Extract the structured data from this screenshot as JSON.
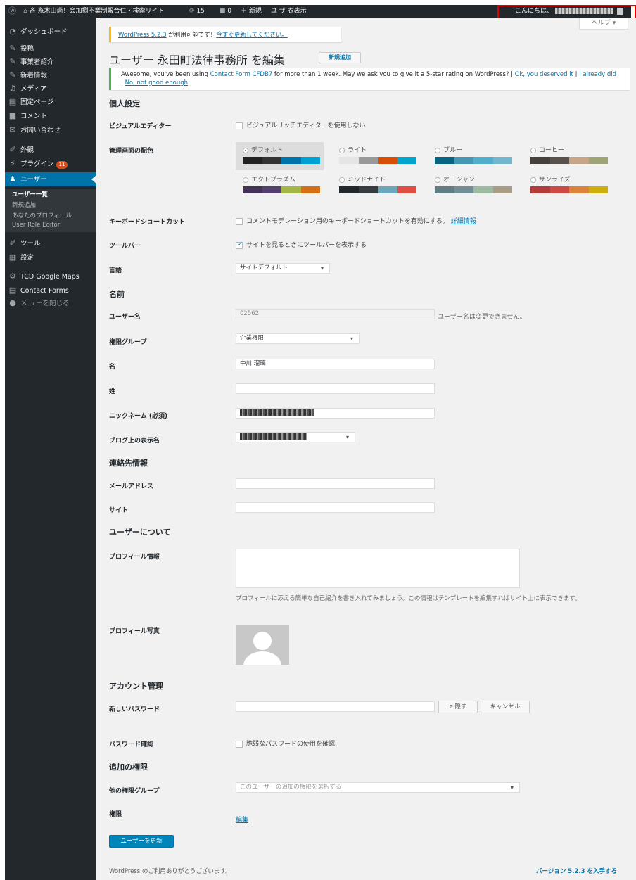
{
  "admin_bar": {
    "site_name": "吝 糸木山尚！会加捌不業制報合仁・検索リイト",
    "updates": "15",
    "comments": "0",
    "new": "新規",
    "user_view": "ユ ザ 衣表示",
    "greeting": "こんにちは、"
  },
  "sidebar": {
    "items": [
      {
        "label": "ダッシュボード",
        "icon": "dashboard-icon"
      },
      {
        "label": "投稿",
        "icon": "pin-icon"
      },
      {
        "label": "事業者紹介",
        "icon": "pin-icon"
      },
      {
        "label": "新着情報",
        "icon": "pin-icon"
      },
      {
        "label": "メディア",
        "icon": "media-icon"
      },
      {
        "label": "固定ページ",
        "icon": "page-icon"
      },
      {
        "label": "コメント",
        "icon": "comment-icon"
      },
      {
        "label": "お問い合わせ",
        "icon": "mail-icon"
      },
      {
        "label": "外観",
        "icon": "appearance-icon"
      },
      {
        "label": "プラグイン",
        "icon": "plugin-icon",
        "badge": "11"
      },
      {
        "label": "ユーザー",
        "icon": "user-icon"
      },
      {
        "label": "ツール",
        "icon": "tools-icon"
      },
      {
        "label": "設定",
        "icon": "settings-icon"
      },
      {
        "label": "TCD Google Maps",
        "icon": "gear-icon"
      },
      {
        "label": "Contact Forms",
        "icon": "form-icon"
      },
      {
        "label": "メ ューを閉じる",
        "icon": "collapse-icon"
      }
    ],
    "submenu": [
      "ユーザー一覧",
      "新規追加",
      "あなたのプロフィール",
      "User Role Editor"
    ]
  },
  "help_label": "ヘルプ ▾",
  "notice_update": {
    "link1": "WordPress 5.2.3",
    "text": " が利用可能です！",
    "link2": "今すぐ更新してください。"
  },
  "page_title": "ユーザー 永田町法律事務所 を編集",
  "add_new": "新規追加",
  "notice_cf7": {
    "text": "Awesome, you've been using ",
    "link1": "Contact Form CFDB7",
    "text2": " for more than 1 week. May we ask you to give it a 5-star rating on WordPress? | ",
    "link2": "Ok, you deserved it",
    "sep": " | ",
    "link3": "I already did",
    "sep2": " | ",
    "link4": "No, not good enough"
  },
  "sections": {
    "personal": "個人設定",
    "name": "名前",
    "contact": "連絡先情報",
    "about": "ユーザーについて",
    "account": "アカウント管理",
    "extra_caps": "追加の権限"
  },
  "labels": {
    "visual_editor": "ビジュアルエディター",
    "color_scheme": "管理画面の配色",
    "keyboard_shortcuts": "キーボードショートカット",
    "toolbar": "ツールバー",
    "language": "言語",
    "username": "ユーザー名",
    "role": "権限グループ",
    "first_name": "名",
    "last_name": "姓",
    "nickname": "ニックネーム (必須)",
    "display_name": "ブログ上の表示名",
    "email": "メールアドレス",
    "website": "サイト",
    "bio": "プロフィール情報",
    "picture": "プロフィール写真",
    "new_password": "新しいパスワード",
    "confirm_password": "パスワード確認",
    "other_roles": "他の権限グループ",
    "capabilities": "権限"
  },
  "options": {
    "visual_editor": "ビジュアルリッチエディターを使用しない",
    "keyboard_shortcuts": "コメントモデレーション用のキーボードショートカットを有効にする。",
    "keyboard_more": "詳細情報",
    "toolbar": "サイトを見るときにツールバーを表示する",
    "weak_password": "脆弱なパスワードの使用を確認"
  },
  "color_schemes": [
    {
      "name": "デフォルト",
      "colors": [
        "#222222",
        "#333333",
        "#0073aa",
        "#00a0d2"
      ],
      "selected": true
    },
    {
      "name": "ライト",
      "colors": [
        "#e5e5e5",
        "#999999",
        "#d64e07",
        "#04a4cc"
      ],
      "selected": false
    },
    {
      "name": "ブルー",
      "colors": [
        "#096484",
        "#4796b3",
        "#52accc",
        "#74b6ce"
      ],
      "selected": false
    },
    {
      "name": "コーヒー",
      "colors": [
        "#46403c",
        "#59524c",
        "#c7a589",
        "#9ea476"
      ],
      "selected": false
    },
    {
      "name": "エクトプラズム",
      "colors": [
        "#413256",
        "#523f6d",
        "#a3b745",
        "#d46f15"
      ],
      "selected": false
    },
    {
      "name": "ミッドナイト",
      "colors": [
        "#25282b",
        "#363b3f",
        "#69a8bb",
        "#e14d43"
      ],
      "selected": false
    },
    {
      "name": "オーシャン",
      "colors": [
        "#627c83",
        "#738e96",
        "#9ebaa0",
        "#aa9d88"
      ],
      "selected": false
    },
    {
      "name": "サンライズ",
      "colors": [
        "#b43c38",
        "#cf4944",
        "#dd823b",
        "#ccaf0b"
      ],
      "selected": false
    }
  ],
  "fields": {
    "language": "サイトデフォルト",
    "username": "02562",
    "username_note": "ユーザー名は変更できません。",
    "role": "企業権限",
    "first_name": "中川 瑠璃",
    "last_name": "",
    "nickname": "",
    "display_name": "",
    "email": "",
    "website": "",
    "bio_note": "プロフィールに添える簡単な自己紹介を書き入れてみましょう。この情報はテンプレートを編集すればサイト上に表示できます。",
    "other_roles_placeholder": "このユーザーの追加の権限を選択する",
    "capabilities_link": "編集"
  },
  "buttons": {
    "hide": "隠す",
    "cancel": "キャンセル",
    "update": "ユーザーを更新"
  },
  "footer": {
    "thanks": "WordPress のご利用ありがとうございます。",
    "version": "バージョン 5.2.3 を入手する"
  }
}
